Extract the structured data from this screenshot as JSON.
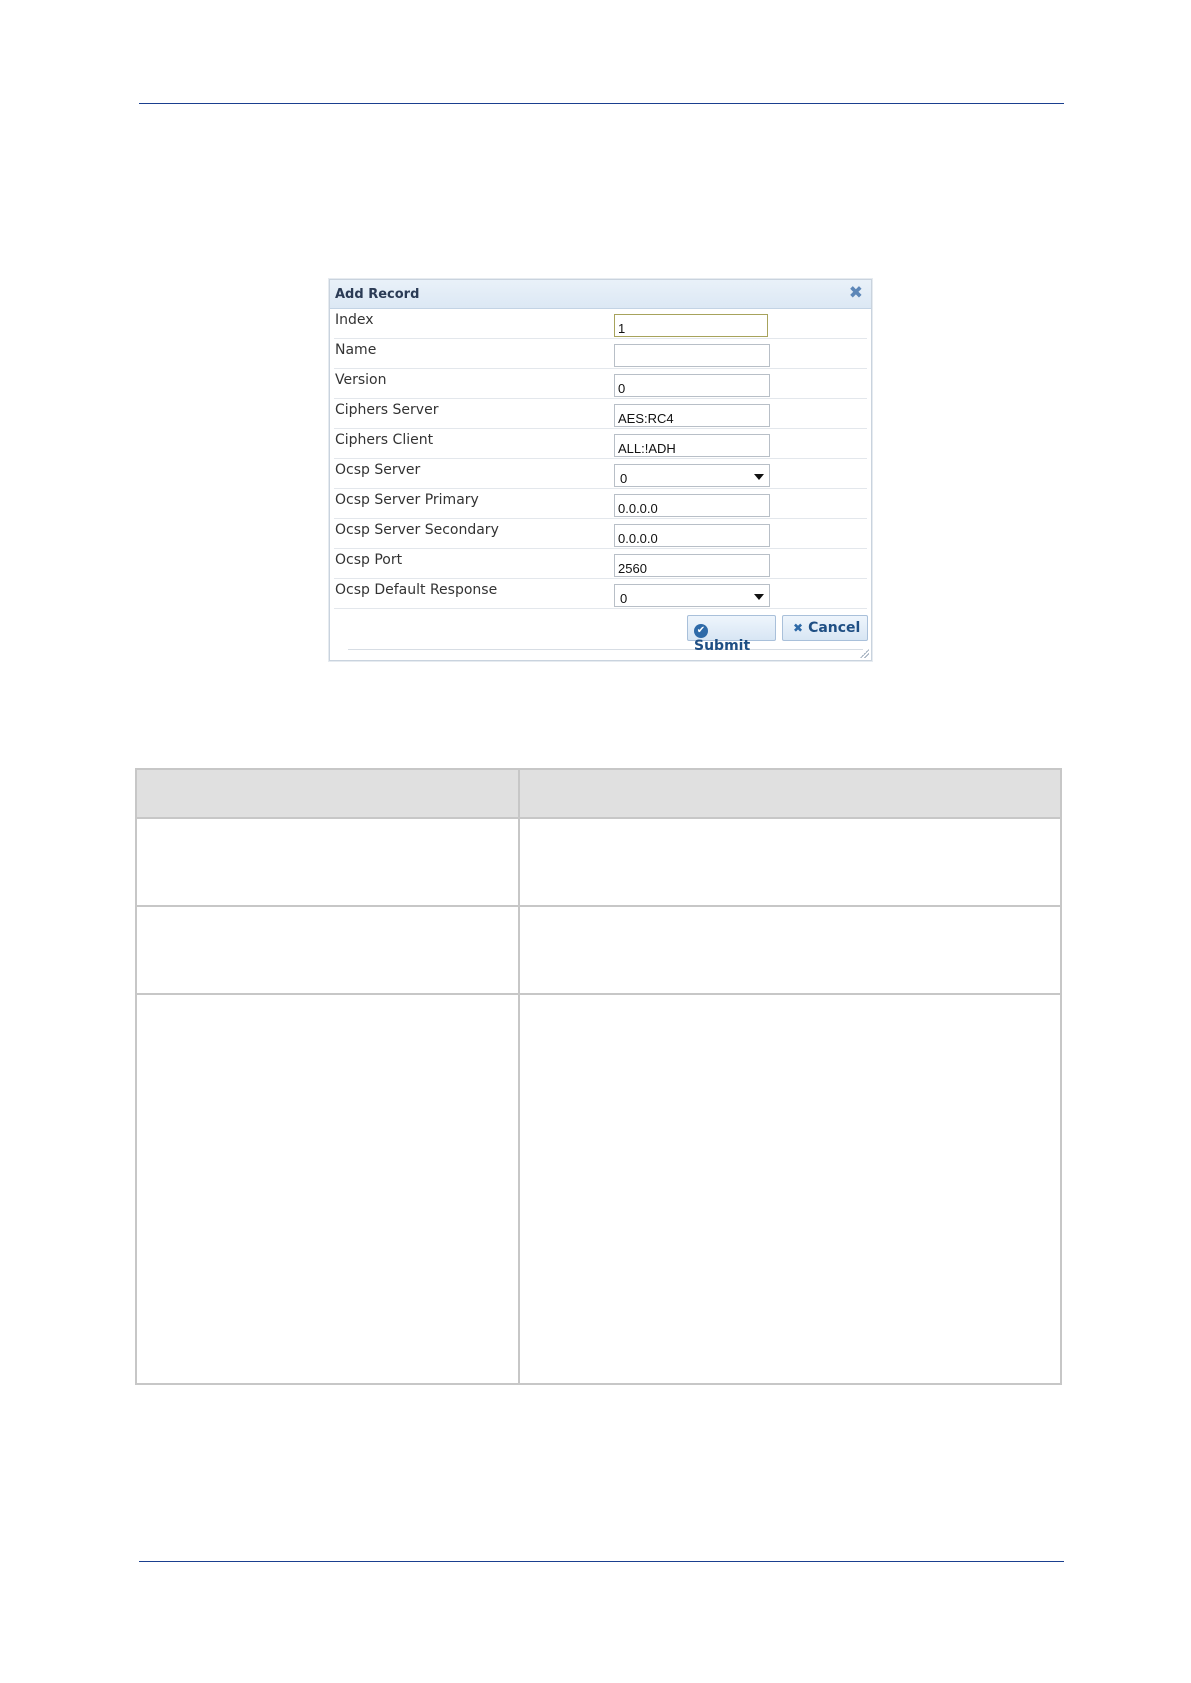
{
  "dialog": {
    "title": "Add Record",
    "close_icon": "close-icon",
    "fields": [
      {
        "label": "Index",
        "value": "1",
        "type": "text"
      },
      {
        "label": "Name",
        "value": "",
        "type": "text"
      },
      {
        "label": "Version",
        "value": "0",
        "type": "text"
      },
      {
        "label": "Ciphers Server",
        "value": "AES:RC4",
        "type": "text"
      },
      {
        "label": "Ciphers Client",
        "value": "ALL:!ADH",
        "type": "text"
      },
      {
        "label": "Ocsp Server",
        "value": "0",
        "type": "select"
      },
      {
        "label": "Ocsp Server Primary",
        "value": "0.0.0.0",
        "type": "text"
      },
      {
        "label": "Ocsp Server Secondary",
        "value": "0.0.0.0",
        "type": "text"
      },
      {
        "label": "Ocsp Port",
        "value": "2560",
        "type": "text"
      },
      {
        "label": "Ocsp Default Response",
        "value": "0",
        "type": "select"
      }
    ],
    "submit_label": "Submit",
    "cancel_label": "Cancel"
  },
  "colors": {
    "rule": "#1a3f8f",
    "header_bg": "#dce8f4",
    "button_text": "#1f4f84",
    "table_header_bg": "#e0e0e0"
  }
}
